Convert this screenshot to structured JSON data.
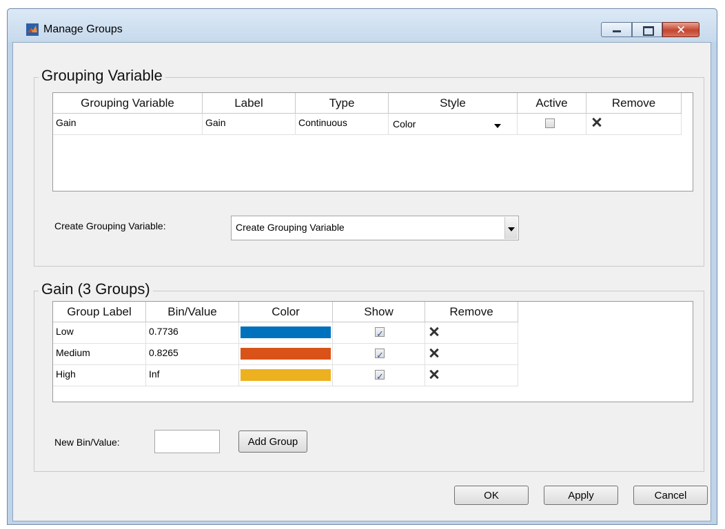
{
  "window": {
    "title": "Manage Groups"
  },
  "grouping_panel": {
    "title": "Grouping Variable",
    "columns": [
      "Grouping Variable",
      "Label",
      "Type",
      "Style",
      "Active",
      "Remove"
    ],
    "rows": [
      {
        "variable": "Gain",
        "label": "Gain",
        "type": "Continuous",
        "style": "Color",
        "active": false
      }
    ],
    "create_label": "Create Grouping Variable:",
    "create_value": "Create Grouping Variable"
  },
  "groups_panel": {
    "title": "Gain (3 Groups)",
    "columns": [
      "Group Label",
      "Bin/Value",
      "Color",
      "Show",
      "Remove"
    ],
    "rows": [
      {
        "label": "Low",
        "value": "0.7736",
        "color": "#0072bd",
        "show": true
      },
      {
        "label": "Medium",
        "value": "0.8265",
        "color": "#d95319",
        "show": true
      },
      {
        "label": "High",
        "value": "Inf",
        "color": "#edb120",
        "show": true
      }
    ],
    "new_bin_label": "New Bin/Value:",
    "new_bin_value": "",
    "add_group_label": "Add Group"
  },
  "buttons": {
    "ok": "OK",
    "apply": "Apply",
    "cancel": "Cancel"
  }
}
